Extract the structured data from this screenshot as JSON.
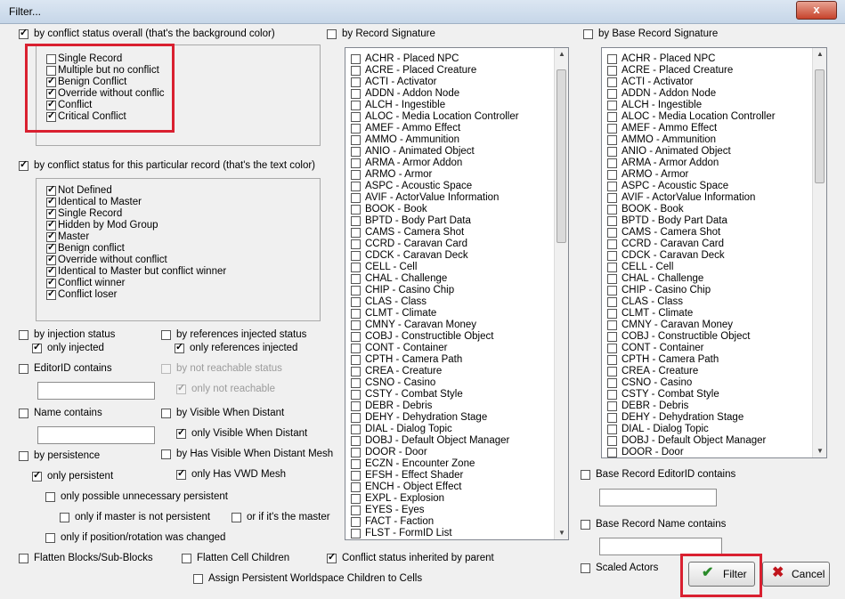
{
  "window": {
    "title": "Filter...",
    "close_glyph": "x"
  },
  "conflict_overall": {
    "label": "by conflict status overall (that's the background color)",
    "checked": true,
    "items": [
      {
        "label": "Single Record",
        "checked": false
      },
      {
        "label": "Multiple but no conflict",
        "checked": false
      },
      {
        "label": "Benign Conflict",
        "checked": true
      },
      {
        "label": "Override without conflic",
        "checked": true
      },
      {
        "label": "Conflict",
        "checked": true
      },
      {
        "label": "Critical Conflict",
        "checked": true
      }
    ]
  },
  "conflict_record": {
    "label": "by conflict status for this particular record  (that's the text color)",
    "checked": true,
    "items": [
      {
        "label": "Not Defined",
        "checked": true
      },
      {
        "label": "Identical to Master",
        "checked": true
      },
      {
        "label": "Single Record",
        "checked": true
      },
      {
        "label": "Hidden by Mod Group",
        "checked": true
      },
      {
        "label": "Master",
        "checked": true
      },
      {
        "label": "Benign conflict",
        "checked": true
      },
      {
        "label": "Override without conflict",
        "checked": true
      },
      {
        "label": "Identical to Master but conflict winner",
        "checked": true
      },
      {
        "label": "Conflict winner",
        "checked": true
      },
      {
        "label": "Conflict loser",
        "checked": true
      }
    ]
  },
  "options": {
    "injection": {
      "label": "by injection status",
      "checked": false
    },
    "only_injected": {
      "label": "only injected",
      "checked": true
    },
    "references_injected": {
      "label": "by references injected status",
      "checked": false
    },
    "only_references_injected": {
      "label": "only references injected",
      "checked": true
    },
    "editorid": {
      "label": "EditorID contains",
      "checked": false,
      "value": ""
    },
    "not_reachable_status": {
      "label": "by not reachable status",
      "checked": false
    },
    "only_not_reachable": {
      "label": "only not reachable",
      "checked": true
    },
    "name": {
      "label": "Name contains",
      "checked": false,
      "value": ""
    },
    "visible_distant": {
      "label": "by Visible When Distant",
      "checked": false
    },
    "only_visible_distant": {
      "label": "only Visible When Distant",
      "checked": true
    },
    "persistence": {
      "label": "by persistence",
      "checked": false
    },
    "only_persistent": {
      "label": "only persistent",
      "checked": true
    },
    "vwd_mesh": {
      "label": "by Has Visible When Distant Mesh",
      "checked": false
    },
    "only_vwd_mesh": {
      "label": "only Has VWD Mesh",
      "checked": true
    },
    "unnecessary_persistent": {
      "label": "only possible unnecessary persistent",
      "checked": false
    },
    "master_not_persistent": {
      "label": "only if master is not persistent",
      "checked": false
    },
    "is_master": {
      "label": "or if it's the master",
      "checked": false
    },
    "position_changed": {
      "label": "only if position/rotation was changed",
      "checked": false
    },
    "flatten_blocks": {
      "label": "Flatten Blocks/Sub-Blocks",
      "checked": false
    },
    "flatten_cell": {
      "label": "Flatten Cell Children",
      "checked": false
    },
    "inherited": {
      "label": "Conflict status inherited by parent",
      "checked": true
    },
    "assign_persistent": {
      "label": "Assign Persistent Worldspace Children to Cells",
      "checked": false
    }
  },
  "record_signature": {
    "label": "by Record Signature",
    "checked": false,
    "items": [
      "ACHR - Placed NPC",
      "ACRE - Placed Creature",
      "ACTI - Activator",
      "ADDN - Addon Node",
      "ALCH - Ingestible",
      "ALOC - Media Location Controller",
      "AMEF - Ammo Effect",
      "AMMO - Ammunition",
      "ANIO - Animated Object",
      "ARMA - Armor Addon",
      "ARMO - Armor",
      "ASPC - Acoustic Space",
      "AVIF - ActorValue Information",
      "BOOK - Book",
      "BPTD - Body Part Data",
      "CAMS - Camera Shot",
      "CCRD - Caravan Card",
      "CDCK - Caravan Deck",
      "CELL - Cell",
      "CHAL - Challenge",
      "CHIP - Casino Chip",
      "CLAS - Class",
      "CLMT - Climate",
      "CMNY - Caravan Money",
      "COBJ - Constructible Object",
      "CONT - Container",
      "CPTH - Camera Path",
      "CREA - Creature",
      "CSNO - Casino",
      "CSTY - Combat Style",
      "DEBR - Debris",
      "DEHY - Dehydration Stage",
      "DIAL - Dialog Topic",
      "DOBJ - Default Object Manager",
      "DOOR - Door",
      "ECZN - Encounter Zone",
      "EFSH - Effect Shader",
      "ENCH - Object Effect",
      "EXPL - Explosion",
      "EYES - Eyes",
      "FACT - Faction",
      "FLST - FormID List"
    ]
  },
  "base_signature": {
    "label": "by Base Record Signature",
    "checked": false,
    "items": [
      "ACHR - Placed NPC",
      "ACRE - Placed Creature",
      "ACTI - Activator",
      "ADDN - Addon Node",
      "ALCH - Ingestible",
      "ALOC - Media Location Controller",
      "AMEF - Ammo Effect",
      "AMMO - Ammunition",
      "ANIO - Animated Object",
      "ARMA - Armor Addon",
      "ARMO - Armor",
      "ASPC - Acoustic Space",
      "AVIF - ActorValue Information",
      "BOOK - Book",
      "BPTD - Body Part Data",
      "CAMS - Camera Shot",
      "CCRD - Caravan Card",
      "CDCK - Caravan Deck",
      "CELL - Cell",
      "CHAL - Challenge",
      "CHIP - Casino Chip",
      "CLAS - Class",
      "CLMT - Climate",
      "CMNY - Caravan Money",
      "COBJ - Constructible Object",
      "CONT - Container",
      "CPTH - Camera Path",
      "CREA - Creature",
      "CSNO - Casino",
      "CSTY - Combat Style",
      "DEBR - Debris",
      "DEHY - Dehydration Stage",
      "DIAL - Dialog Topic",
      "DOBJ - Default Object Manager",
      "DOOR - Door"
    ]
  },
  "base_editorid": {
    "label": "Base Record EditorID contains",
    "checked": false,
    "value": ""
  },
  "base_name": {
    "label": "Base Record Name contains",
    "checked": false,
    "value": ""
  },
  "scaled_actors": {
    "label": "Scaled Actors",
    "checked": false
  },
  "buttons": {
    "filter": "Filter",
    "cancel": "Cancel"
  },
  "colors": {
    "highlight": "#d92030",
    "ok_green": "#2a8a2a",
    "cancel_red": "#c0141c"
  }
}
